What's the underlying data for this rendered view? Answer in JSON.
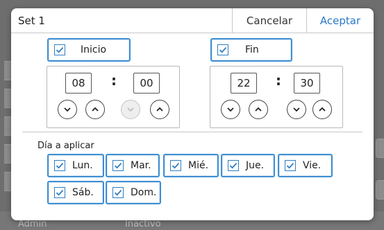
{
  "background": {
    "user": "Admin",
    "status": "Inactivo"
  },
  "dialog": {
    "title": "Set 1",
    "cancel_label": "Cancelar",
    "accept_label": "Aceptar"
  },
  "start": {
    "label": "Inicio",
    "checked": true,
    "hour": "08",
    "minute": "00",
    "separator": ":"
  },
  "end": {
    "label": "Fin",
    "checked": true,
    "hour": "22",
    "minute": "30",
    "separator": ":"
  },
  "days": {
    "section_label": "Día a aplicar",
    "items": [
      {
        "label": "Lun.",
        "checked": true
      },
      {
        "label": "Mar.",
        "checked": true
      },
      {
        "label": "Mié.",
        "checked": true
      },
      {
        "label": "Jue.",
        "checked": true
      },
      {
        "label": "Vie.",
        "checked": true
      },
      {
        "label": "Sáb.",
        "checked": true
      },
      {
        "label": "Dom.",
        "checked": true
      }
    ]
  },
  "colors": {
    "accent": "#2a78c8",
    "checkbox_border": "#3f8fd2"
  },
  "icons": {
    "check": "check-icon",
    "down": "chevron-down-icon",
    "up": "chevron-up-icon"
  }
}
